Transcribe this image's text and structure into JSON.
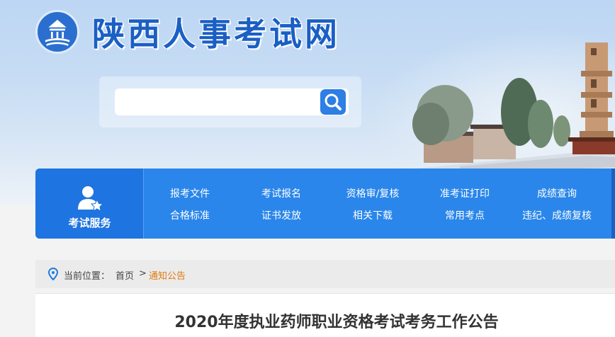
{
  "header": {
    "site_title": "陕西人事考试网",
    "logo_icon": "pagoda-emblem-icon"
  },
  "search": {
    "value": "",
    "placeholder": "",
    "button_icon": "search-icon"
  },
  "nav": {
    "service_label": "考试服务",
    "service_icon": "user-star-icon",
    "links": [
      {
        "label": "报考文件"
      },
      {
        "label": "考试报名"
      },
      {
        "label": "资格审/复核"
      },
      {
        "label": "准考证打印"
      },
      {
        "label": "成绩查询"
      },
      {
        "label": "合格标准"
      },
      {
        "label": "证书发放"
      },
      {
        "label": "相关下载"
      },
      {
        "label": "常用考点"
      },
      {
        "label": "违纪、成绩复核"
      }
    ]
  },
  "breadcrumb": {
    "icon": "location-pin-icon",
    "prefix": "当前位置：",
    "home": "首页",
    "separator": ">",
    "current": "通知公告"
  },
  "article": {
    "title": "2020年度执业药师职业资格考试考务工作公告"
  },
  "colors": {
    "brand_blue": "#2a86ea",
    "title_blue": "#1a5fc4",
    "crumb_current": "#e07a10"
  }
}
